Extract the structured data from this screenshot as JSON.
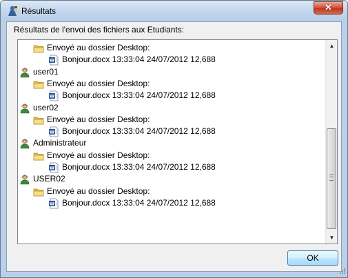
{
  "window": {
    "title": "Résultats",
    "close_label": "✕"
  },
  "heading": "Résultats de l'envoi des fichiers aux Etudiants:",
  "list": [
    {
      "type": "folder",
      "text": "Envoyé au dossier Desktop:"
    },
    {
      "type": "file",
      "text": "Bonjour.docx 13:33:04 24/07/2012 12,688"
    },
    {
      "type": "user",
      "text": "user01"
    },
    {
      "type": "folder",
      "text": "Envoyé au dossier Desktop:"
    },
    {
      "type": "file",
      "text": "Bonjour.docx 13:33:04 24/07/2012 12,688"
    },
    {
      "type": "user",
      "text": "user02"
    },
    {
      "type": "folder",
      "text": "Envoyé au dossier Desktop:"
    },
    {
      "type": "file",
      "text": "Bonjour.docx 13:33:04 24/07/2012 12,688"
    },
    {
      "type": "user",
      "text": "Administrateur"
    },
    {
      "type": "folder",
      "text": "Envoyé au dossier Desktop:"
    },
    {
      "type": "file",
      "text": "Bonjour.docx 13:33:04 24/07/2012 12,688"
    },
    {
      "type": "user",
      "text": "USER02"
    },
    {
      "type": "folder",
      "text": "Envoyé au dossier Desktop:"
    },
    {
      "type": "file",
      "text": "Bonjour.docx 13:33:04 24/07/2012 12,688"
    }
  ],
  "icons": {
    "user": "user-icon",
    "folder": "folder-icon",
    "file": "word-document-icon"
  },
  "ok_label": "OK"
}
